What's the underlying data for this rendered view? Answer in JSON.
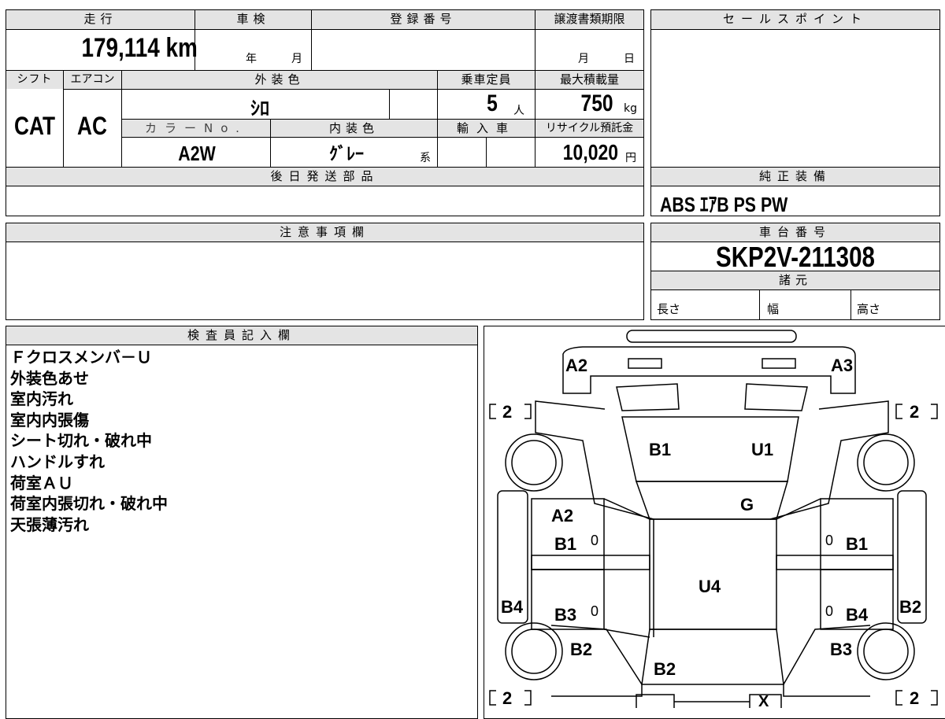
{
  "mileage": {
    "label": "走行",
    "value": "179,114 km"
  },
  "inspection": {
    "label": "車検",
    "year_unit": "年",
    "month_unit": "月"
  },
  "registration": {
    "label": "登録番号"
  },
  "transfer_deadline": {
    "label": "譲渡書類期限",
    "month_unit": "月",
    "day_unit": "日"
  },
  "sales_points": {
    "label": "セールスポイント"
  },
  "shift": {
    "label": "シフト",
    "value": "CAT"
  },
  "aircon": {
    "label": "エアコン",
    "value": "AC"
  },
  "exterior_color": {
    "label": "外装色",
    "value": "ｼﾛ"
  },
  "capacity": {
    "label": "乗車定員",
    "value": "5",
    "unit": "人"
  },
  "max_load": {
    "label": "最大積載量",
    "value": "750",
    "unit": "kg"
  },
  "color_no": {
    "label": "カラーNo.",
    "value": "A2W"
  },
  "interior_color": {
    "label": "内装色",
    "value": "ｸﾞﾚｰ",
    "suffix": "系"
  },
  "import_car": {
    "label": "輸入車"
  },
  "recycle_fee": {
    "label": "リサイクル預託金",
    "value": "10,020",
    "unit": "円"
  },
  "later_parts": {
    "label": "後日発送部品"
  },
  "genuine_equipment": {
    "label": "純正装備",
    "value": "ABS ｴｱB PS PW"
  },
  "caution": {
    "label": "注意事項欄"
  },
  "chassis_no": {
    "label": "車台番号",
    "value": "SKP2V-211308"
  },
  "specs": {
    "label": "諸元",
    "length": "長さ",
    "width": "幅",
    "height": "高さ"
  },
  "inspector": {
    "label": "検査員記入欄",
    "notes": [
      "Ｆクロスメンバ－Ｕ",
      "外装色あせ",
      "室内汚れ",
      "室内内張傷",
      "シート切れ・破れ中",
      "ハンドルすれ",
      "荷室ＡＵ",
      "荷室内張切れ・破れ中",
      "天張薄汚れ"
    ]
  },
  "diagram": {
    "labels": {
      "front_left": "A2",
      "front_right": "A3",
      "hood_left": "B1",
      "hood_right": "U1",
      "windshield": "G",
      "front_door_left_top": "A2",
      "front_door_left": "B1",
      "front_door_right": "B1",
      "roof": "U4",
      "rear_door_left": "B3",
      "rear_door_right": "B4",
      "side_left": "B4",
      "side_right": "B2",
      "rear_quarter_left": "B2",
      "rear_quarter_right": "B3",
      "back": "B2",
      "rear_bumper": "X"
    },
    "tire_tl": "2",
    "tire_tr": "2",
    "tire_bl": "2",
    "tire_br": "2",
    "zero_a": "0",
    "zero_b": "0",
    "zero_c": "0",
    "zero_d": "0"
  }
}
